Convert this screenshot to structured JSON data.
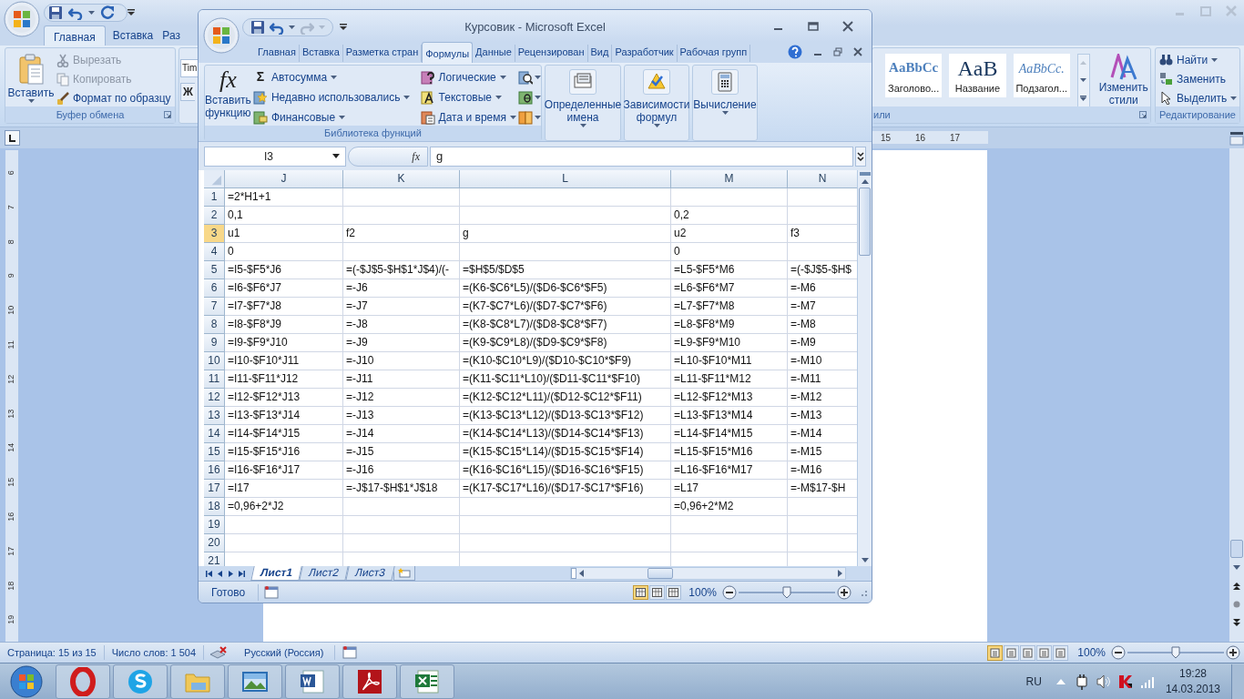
{
  "word": {
    "tabs": [
      {
        "label": "Главная",
        "selected": true
      },
      {
        "label": "Вставка",
        "selected": false
      },
      {
        "label": "Раз",
        "selected": false
      }
    ],
    "clipboard": {
      "paste": "Вставить",
      "items": [
        {
          "label": "Вырезать",
          "disabled": true
        },
        {
          "label": "Копировать",
          "disabled": true
        },
        {
          "label": "Формат по образцу",
          "disabled": false
        }
      ],
      "group_label": "Буфер обмена"
    },
    "font": {
      "font_name": "Tim",
      "bold": "Ж"
    },
    "styles": {
      "items": [
        {
          "kind": "heading",
          "sample": "AaBbCc",
          "label": "Заголово..."
        },
        {
          "kind": "title",
          "sample": "AaB",
          "label": "Название"
        },
        {
          "kind": "subtitle",
          "sample": "AaBbCc.",
          "label": "Подзагол..."
        }
      ],
      "change_styles": "Изменить стили",
      "group_label": "или"
    },
    "editing": {
      "items": [
        {
          "label": "Найти",
          "dropdown": true
        },
        {
          "label": "Заменить",
          "dropdown": false
        },
        {
          "label": "Выделить",
          "dropdown": true
        }
      ],
      "group_label": "Редактирование"
    },
    "ruler": [
      "15",
      "16",
      "17"
    ],
    "vertical_ruler": [
      "6",
      "7",
      "8",
      "9",
      "10",
      "11",
      "12",
      "13",
      "14",
      "15",
      "16",
      "17",
      "18",
      "19"
    ],
    "status_bar": {
      "page": "Страница: 15 из 15",
      "words": "Число слов: 1 504",
      "language": "Русский (Россия)",
      "zoom": "100%",
      "zoom_slider": {
        "level": 0.5
      }
    }
  },
  "excel": {
    "title": "Курсовик - Microsoft Excel",
    "tabs": [
      {
        "label": "Главная",
        "selected": false
      },
      {
        "label": "Вставка",
        "selected": false
      },
      {
        "label": "Разметка стран",
        "selected": false
      },
      {
        "label": "Формулы",
        "selected": true
      },
      {
        "label": "Данные",
        "selected": false
      },
      {
        "label": "Рецензирован",
        "selected": false
      },
      {
        "label": "Вид",
        "selected": false
      },
      {
        "label": "Разработчик",
        "selected": false
      },
      {
        "label": "Рабочая групп",
        "selected": false
      }
    ],
    "function_library": {
      "fx_symbol": "fx",
      "insert_function": "Вставить функцию",
      "sum_symbol": "Σ",
      "items": [
        {
          "kind": "sum",
          "label": "Автосумма"
        },
        {
          "kind": "recent",
          "label": "Недавно использовались"
        },
        {
          "kind": "financial",
          "label": "Финансовые"
        },
        {
          "kind": "logical",
          "label": "Логические"
        },
        {
          "kind": "text",
          "label": "Текстовые"
        },
        {
          "kind": "datetime",
          "label": "Дата и время"
        }
      ],
      "group_label": "Библиотека функций"
    },
    "groups": [
      {
        "kind": "names",
        "label": "Определенные имена"
      },
      {
        "kind": "audit",
        "label": "Зависимости формул"
      },
      {
        "kind": "calc",
        "label": "Вычисление"
      }
    ],
    "name_box": "I3",
    "fx_symbol": "fx",
    "formula": "g",
    "columns": [
      {
        "label": "J",
        "selected": false
      },
      {
        "label": "K",
        "selected": false
      },
      {
        "label": "L",
        "selected": false
      },
      {
        "label": "M",
        "selected": false
      },
      {
        "label": "N",
        "selected": false
      }
    ],
    "rows": [
      {
        "number": "1",
        "selected": false,
        "j": "=2*H1+1"
      },
      {
        "number": "2",
        "selected": false,
        "j": "0,1",
        "m": "0,2"
      },
      {
        "number": "3",
        "selected": true,
        "j": "u1",
        "k": "f2",
        "l": "g",
        "m": "u2",
        "n": "f3"
      },
      {
        "number": "4",
        "selected": false,
        "j": "0",
        "m": "0"
      },
      {
        "number": "5",
        "selected": false,
        "j": "=I5-$F5*J6",
        "k": "=(-$J$5-$H$1*J$4)/(-",
        "l": "=$H$5/$D$5",
        "m": "=L5-$F5*M6",
        "n": "=(-$J$5-$H$"
      },
      {
        "number": "6",
        "selected": false,
        "j": "=I6-$F6*J7",
        "k": "=-J6",
        "l": "=(K6-$C6*L5)/($D6-$C6*$F5)",
        "m": "=L6-$F6*M7",
        "n": "=-M6"
      },
      {
        "number": "7",
        "selected": false,
        "j": "=I7-$F7*J8",
        "k": "=-J7",
        "l": "=(K7-$C7*L6)/($D7-$C7*$F6)",
        "m": "=L7-$F7*M8",
        "n": "=-M7"
      },
      {
        "number": "8",
        "selected": false,
        "j": "=I8-$F8*J9",
        "k": "=-J8",
        "l": "=(K8-$C8*L7)/($D8-$C8*$F7)",
        "m": "=L8-$F8*M9",
        "n": "=-M8"
      },
      {
        "number": "9",
        "selected": false,
        "j": "=I9-$F9*J10",
        "k": "=-J9",
        "l": "=(K9-$C9*L8)/($D9-$C9*$F8)",
        "m": "=L9-$F9*M10",
        "n": "=-M9"
      },
      {
        "number": "10",
        "selected": false,
        "j": "=I10-$F10*J11",
        "k": "=-J10",
        "l": "=(K10-$C10*L9)/($D10-$C10*$F9)",
        "m": "=L10-$F10*M11",
        "n": "=-M10"
      },
      {
        "number": "11",
        "selected": false,
        "j": "=I11-$F11*J12",
        "k": "=-J11",
        "l": "=(K11-$C11*L10)/($D11-$C11*$F10)",
        "m": "=L11-$F11*M12",
        "n": "=-M11"
      },
      {
        "number": "12",
        "selected": false,
        "j": "=I12-$F12*J13",
        "k": "=-J12",
        "l": "=(K12-$C12*L11)/($D12-$C12*$F11)",
        "m": "=L12-$F12*M13",
        "n": "=-M12"
      },
      {
        "number": "13",
        "selected": false,
        "j": "=I13-$F13*J14",
        "k": "=-J13",
        "l": "=(K13-$C13*L12)/($D13-$C13*$F12)",
        "m": "=L13-$F13*M14",
        "n": "=-M13"
      },
      {
        "number": "14",
        "selected": false,
        "j": "=I14-$F14*J15",
        "k": "=-J14",
        "l": "=(K14-$C14*L13)/($D14-$C14*$F13)",
        "m": "=L14-$F14*M15",
        "n": "=-M14"
      },
      {
        "number": "15",
        "selected": false,
        "j": "=I15-$F15*J16",
        "k": "=-J15",
        "l": "=(K15-$C15*L14)/($D15-$C15*$F14)",
        "m": "=L15-$F15*M16",
        "n": "=-M15"
      },
      {
        "number": "16",
        "selected": false,
        "j": "=I16-$F16*J17",
        "k": "=-J16",
        "l": "=(K16-$C16*L15)/($D16-$C16*$F15)",
        "m": "=L16-$F16*M17",
        "n": "=-M16"
      },
      {
        "number": "17",
        "selected": false,
        "j": "=I17",
        "k": "=-J$17-$H$1*J$18",
        "l": "=(K17-$C17*L16)/($D17-$C17*$F16)",
        "m": "=L17",
        "n": "=-M$17-$H"
      },
      {
        "number": "18",
        "selected": false,
        "j": "=0,96+2*J2",
        "m": "=0,96+2*M2"
      },
      {
        "number": "19",
        "selected": false
      },
      {
        "number": "20",
        "selected": false
      },
      {
        "number": "21",
        "selected": false
      }
    ],
    "sheets": [
      {
        "label": "Лист1",
        "selected": true
      },
      {
        "label": "Лист2",
        "selected": false
      },
      {
        "label": "Лист3",
        "selected": false
      }
    ],
    "status": "Готово",
    "zoom": "100%",
    "zoom_slider": {
      "level": 0.5
    }
  },
  "taskbar": {
    "language": "RU",
    "time": "19:28",
    "date": "14.03.2013"
  }
}
